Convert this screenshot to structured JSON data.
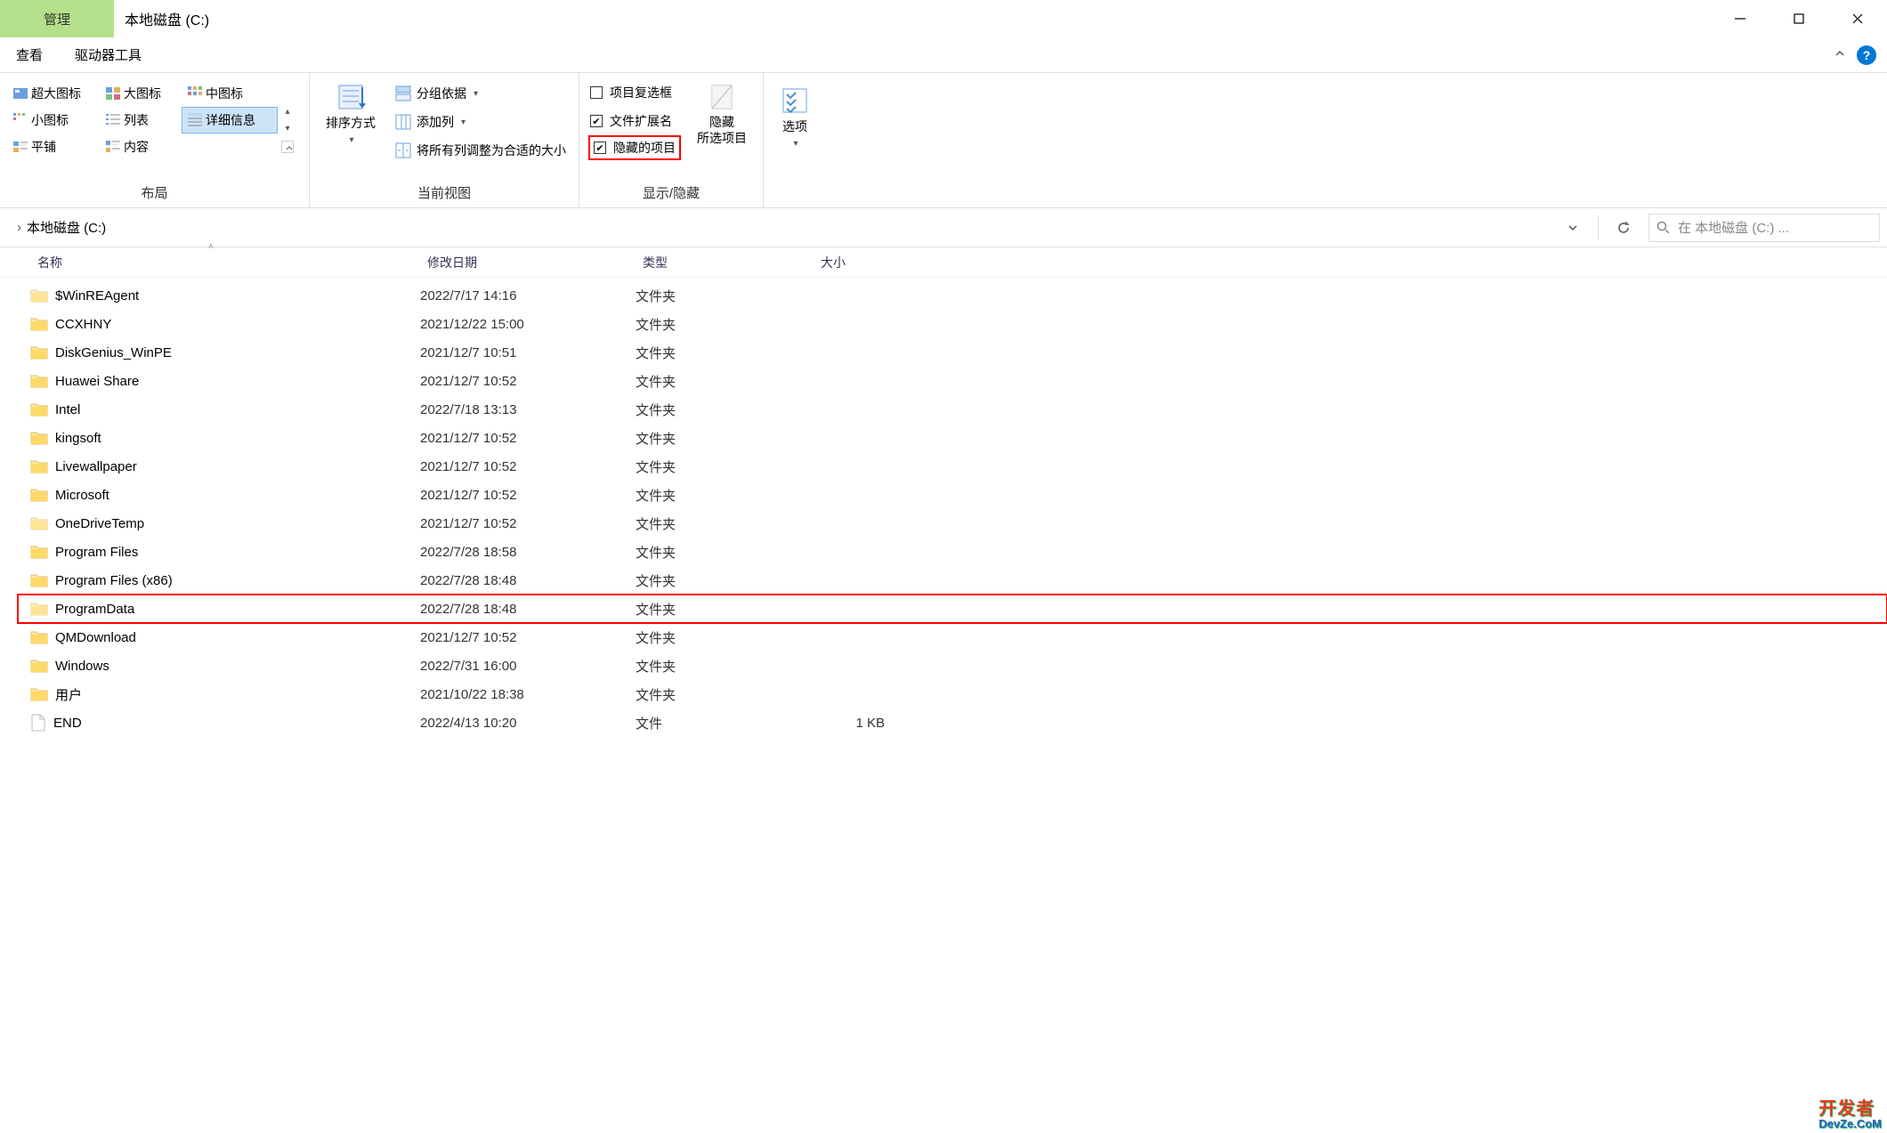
{
  "titlebar": {
    "manage_tab": "管理",
    "title": "本地磁盘 (C:)"
  },
  "tabs": {
    "view": "查看",
    "drive_tools": "驱动器工具"
  },
  "ribbon": {
    "layout": {
      "extra_large": "超大图标",
      "large": "大图标",
      "medium": "中图标",
      "small": "小图标",
      "list": "列表",
      "details": "详细信息",
      "tiles": "平铺",
      "content": "内容",
      "group_label": "布局"
    },
    "current_view": {
      "sort_by": "排序方式",
      "group_by": "分组依据",
      "add_columns": "添加列",
      "fit_columns": "将所有列调整为合适的大小",
      "group_label": "当前视图"
    },
    "show_hide": {
      "item_checkboxes": "项目复选框",
      "file_ext": "文件扩展名",
      "hidden_items": "隐藏的项目",
      "hide_btn_line1": "隐藏",
      "hide_btn_line2": "所选项目",
      "group_label": "显示/隐藏"
    },
    "options": {
      "label": "选项"
    }
  },
  "address": {
    "location": "本地磁盘 (C:)",
    "search_placeholder": "在 本地磁盘 (C:) ..."
  },
  "columns": {
    "name": "名称",
    "date": "修改日期",
    "type": "类型",
    "size": "大小"
  },
  "type_labels": {
    "folder": "文件夹",
    "file": "文件"
  },
  "files": [
    {
      "name": "$WinREAgent",
      "date": "2022/7/17 14:16",
      "type": "folder",
      "size": "",
      "faded": true
    },
    {
      "name": "CCXHNY",
      "date": "2021/12/22 15:00",
      "type": "folder",
      "size": ""
    },
    {
      "name": "DiskGenius_WinPE",
      "date": "2021/12/7 10:51",
      "type": "folder",
      "size": ""
    },
    {
      "name": "Huawei Share",
      "date": "2021/12/7 10:52",
      "type": "folder",
      "size": ""
    },
    {
      "name": "Intel",
      "date": "2022/7/18 13:13",
      "type": "folder",
      "size": ""
    },
    {
      "name": "kingsoft",
      "date": "2021/12/7 10:52",
      "type": "folder",
      "size": ""
    },
    {
      "name": "Livewallpaper",
      "date": "2021/12/7 10:52",
      "type": "folder",
      "size": ""
    },
    {
      "name": "Microsoft",
      "date": "2021/12/7 10:52",
      "type": "folder",
      "size": ""
    },
    {
      "name": "OneDriveTemp",
      "date": "2021/12/7 10:52",
      "type": "folder",
      "size": "",
      "faded": true
    },
    {
      "name": "Program Files",
      "date": "2022/7/28 18:58",
      "type": "folder",
      "size": ""
    },
    {
      "name": "Program Files (x86)",
      "date": "2022/7/28 18:48",
      "type": "folder",
      "size": ""
    },
    {
      "name": "ProgramData",
      "date": "2022/7/28 18:48",
      "type": "folder",
      "size": "",
      "highlighted": true,
      "faded": true
    },
    {
      "name": "QMDownload",
      "date": "2021/12/7 10:52",
      "type": "folder",
      "size": ""
    },
    {
      "name": "Windows",
      "date": "2022/7/31 16:00",
      "type": "folder",
      "size": ""
    },
    {
      "name": "用户",
      "date": "2021/10/22 18:38",
      "type": "folder",
      "size": ""
    },
    {
      "name": "END",
      "date": "2022/4/13 10:20",
      "type": "file",
      "size": "1 KB"
    }
  ],
  "watermark": {
    "line1": "开发者",
    "line2": "DevZe.CoM"
  }
}
